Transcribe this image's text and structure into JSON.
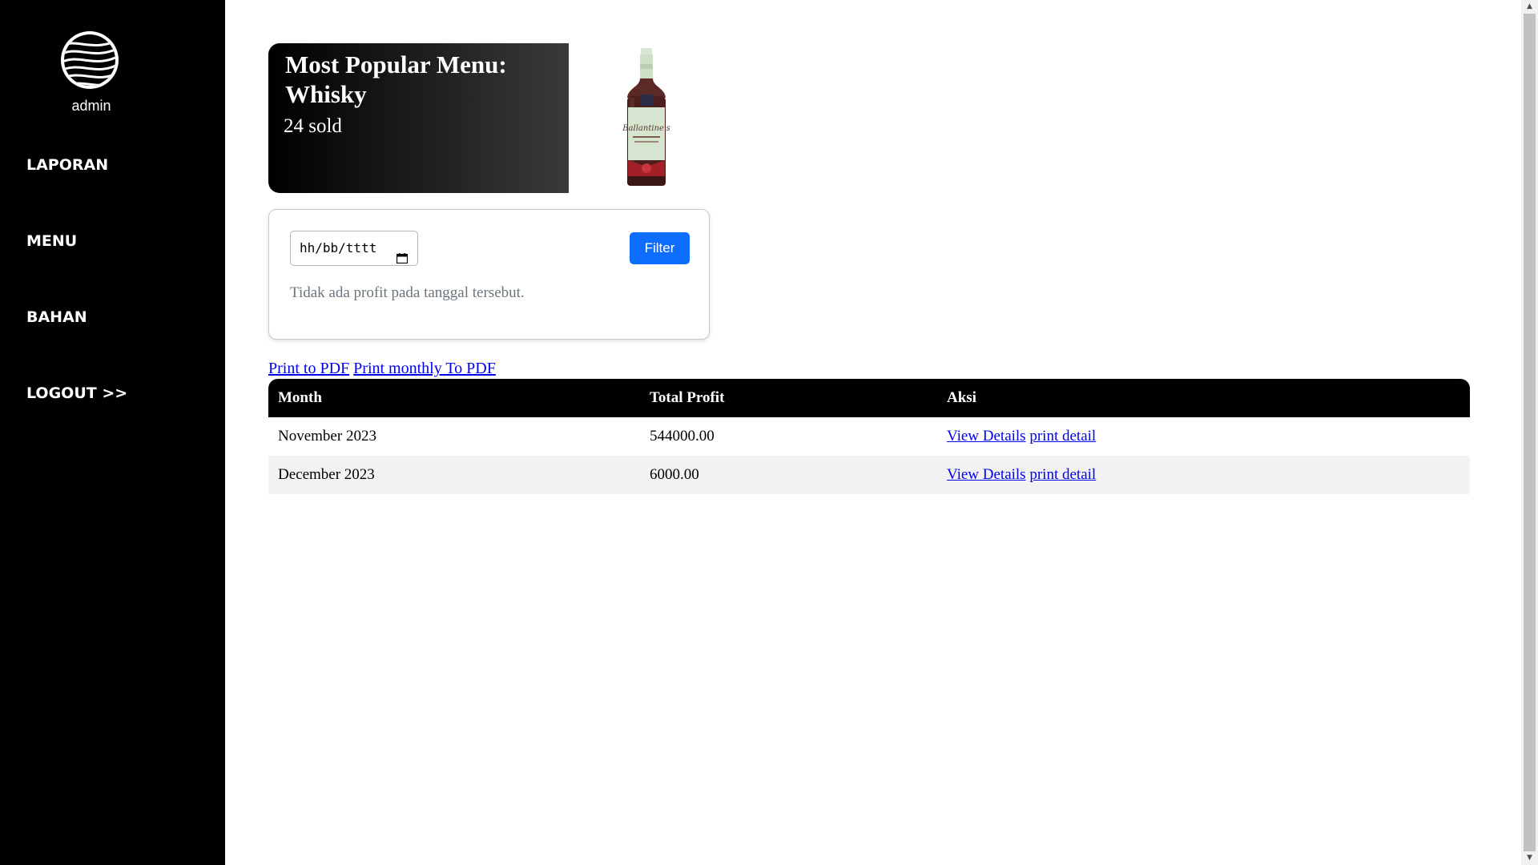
{
  "sidebar": {
    "username": "admin",
    "items": [
      {
        "label": "LAPORAN"
      },
      {
        "label": "MENU"
      },
      {
        "label": "BAHAN"
      },
      {
        "label": "LOGOUT >>"
      }
    ]
  },
  "popular": {
    "title": "Most Popular Menu: Whisky",
    "sold": "24 sold",
    "image_icon": "whisky-bottle"
  },
  "filter": {
    "date_placeholder": "hh/bb/tttt",
    "button_label": "Filter",
    "message": "Tidak ada profit pada tanggal tersebut."
  },
  "print": {
    "pdf_label": "Print to PDF",
    "monthly_pdf_label": "Print monthly To PDF"
  },
  "table": {
    "headers": [
      "Month",
      "Total Profit",
      "Aksi"
    ],
    "rows": [
      {
        "month": "November 2023",
        "profit": "544000.00",
        "view": "View Details",
        "print": "print detail"
      },
      {
        "month": "December 2023",
        "profit": "6000.00",
        "view": "View Details",
        "print": "print detail"
      }
    ]
  },
  "colors": {
    "sidebar_bg": "#000000",
    "accent": "#0d6efd",
    "link": "#0000ee"
  }
}
